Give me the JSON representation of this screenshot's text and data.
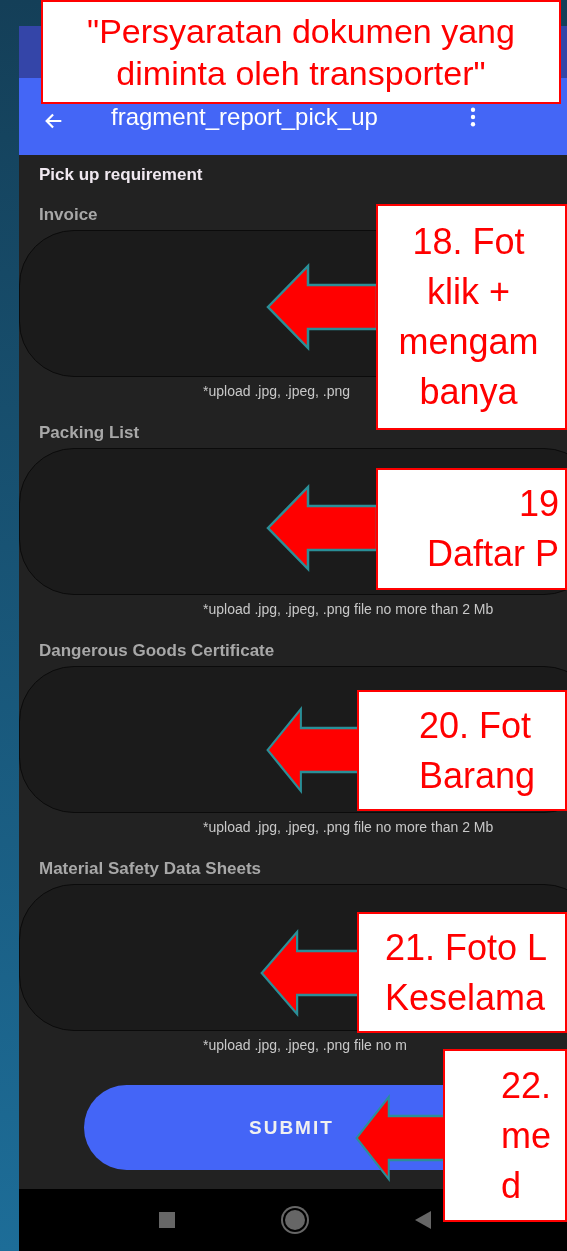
{
  "app_bar": {
    "title": "fragment_report_pick_up"
  },
  "heading": "Pick up requirement",
  "sections": [
    {
      "label": "Invoice",
      "hint": "*upload .jpg, .jpeg, .png"
    },
    {
      "label": "Packing List",
      "hint": "*upload .jpg, .jpeg, .png file no more than 2 Mb"
    },
    {
      "label": "Dangerous Goods Certificate",
      "hint": "*upload .jpg, .jpeg, .png file no more than 2 Mb"
    },
    {
      "label": "Material Safety Data Sheets",
      "hint": "*upload .jpg, .jpeg, .png file no m"
    }
  ],
  "submit": "SUBMIT",
  "annotations": [
    {
      "kind": "title",
      "lines": [
        "\"Persyaratan dokumen yang",
        "diminta oleh transporter\""
      ]
    },
    {
      "kind": "callout",
      "lines": [
        "18. Fot",
        "klik +",
        "mengam",
        "banya"
      ]
    },
    {
      "kind": "callout",
      "lines": [
        "19",
        "Daftar P"
      ]
    },
    {
      "kind": "callout",
      "lines": [
        "20. Fot",
        "Barang"
      ]
    },
    {
      "kind": "callout",
      "lines": [
        "21. Foto L",
        "Keselama"
      ]
    },
    {
      "kind": "callout",
      "lines": [
        "22.",
        "me",
        "d"
      ]
    }
  ]
}
